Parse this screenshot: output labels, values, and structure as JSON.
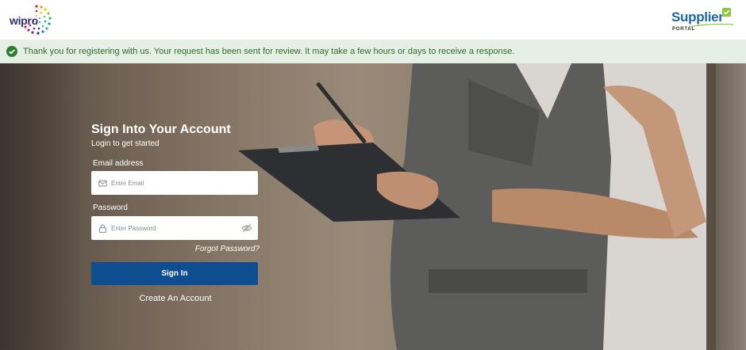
{
  "header": {
    "left_logo": {
      "text": "wipro",
      "icon": "wipro-logo-icon"
    },
    "right_logo": {
      "title": "Supplier",
      "subtitle": "PORTAL",
      "icon": "supplier-portal-logo-icon"
    }
  },
  "banner": {
    "icon": "check-circle-icon",
    "message": "Thank you for registering with us. Your request has been sent for review. It may take a few hours or days to receive a response."
  },
  "login": {
    "title": "Sign Into Your Account",
    "subtitle": "Login to get started",
    "email": {
      "label": "Email address",
      "placeholder": "Enter Email",
      "value": "",
      "icon": "envelope-icon"
    },
    "password": {
      "label": "Password",
      "placeholder": "Enter Password",
      "value": "",
      "icon": "lock-icon",
      "toggle_icon": "eye-off-icon"
    },
    "forgot_password": "Forgot Password?",
    "sign_in_label": "Sign In",
    "create_account": "Create An Account"
  },
  "colors": {
    "banner_bg": "#e6efe4",
    "banner_text": "#2f6b2f",
    "success_green": "#2e7d32",
    "primary_button": "#0e4d8f",
    "supplier_blue": "#1b67a8"
  }
}
